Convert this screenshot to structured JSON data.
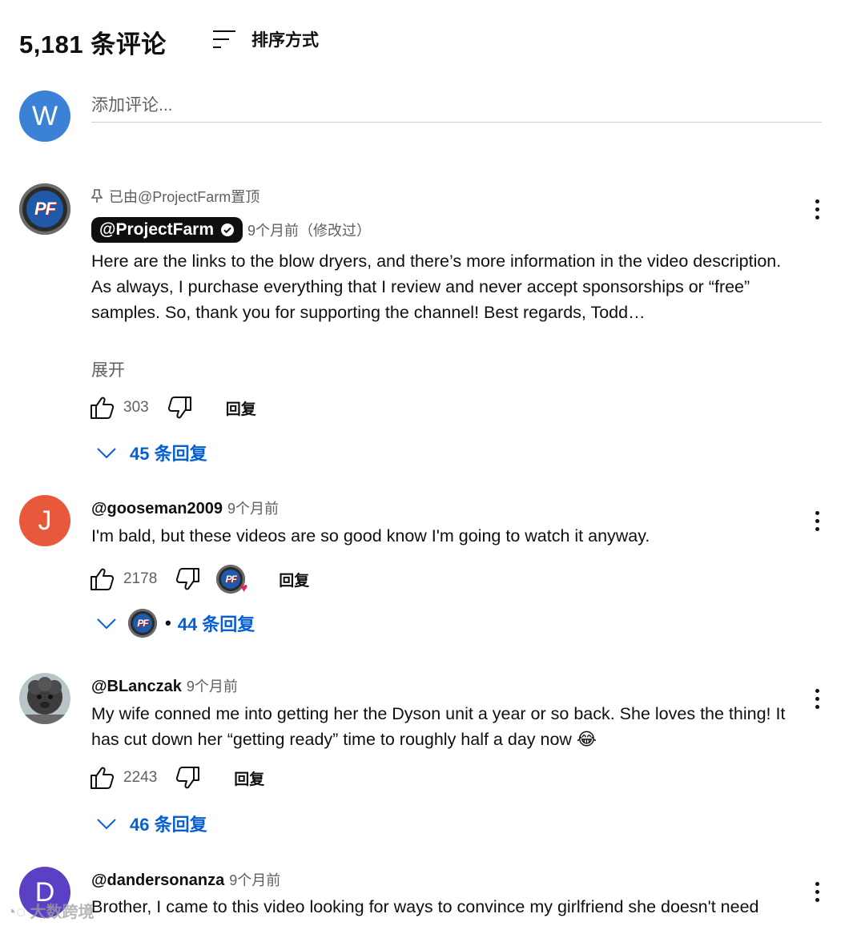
{
  "header": {
    "count": "5,181 条评论",
    "sort_label": "排序方式"
  },
  "add_comment": {
    "avatar_letter": "W",
    "avatar_color": "#3b82d6",
    "placeholder": "添加评论..."
  },
  "comments": [
    {
      "pinned": "已由@ProjectFarm置顶",
      "author": "@ProjectFarm",
      "verified": true,
      "avatar": "PF",
      "time": "9个月前（修改过）",
      "text": "Here are the links to the blow dryers, and there’s more information in the video description. As always, I purchase everything that I review and never accept sponsorships or “free” samples. So, thank you for supporting the channel! Best regards, Todd…",
      "expand": "展开",
      "likes": "303",
      "reply_label": "回复",
      "replies": "45 条回复"
    },
    {
      "author": "@gooseman2009",
      "avatar_letter": "J",
      "avatar_color": "#e8583a",
      "time": "9个月前",
      "text": "I'm bald, but these videos are so good know I'm going to watch it anyway.",
      "likes": "2178",
      "reply_label": "回复",
      "replies": "44 条回复",
      "creator_hearted": true
    },
    {
      "author": "@BLanczak",
      "time": "9个月前",
      "text": "My wife conned me into getting her the Dyson unit a year or so back. She loves the thing! It has cut down her “getting ready” time to roughly half a day now 😂",
      "likes": "2243",
      "reply_label": "回复",
      "replies": "46 条回复"
    },
    {
      "author": "@dandersonanza",
      "avatar_letter": "D",
      "avatar_color": "#5b3fc4",
      "time": "9个月前",
      "text": "Brother, I came to this video looking for ways to convince my girlfriend she doesn't need"
    }
  ],
  "watermark": "大数跨境"
}
